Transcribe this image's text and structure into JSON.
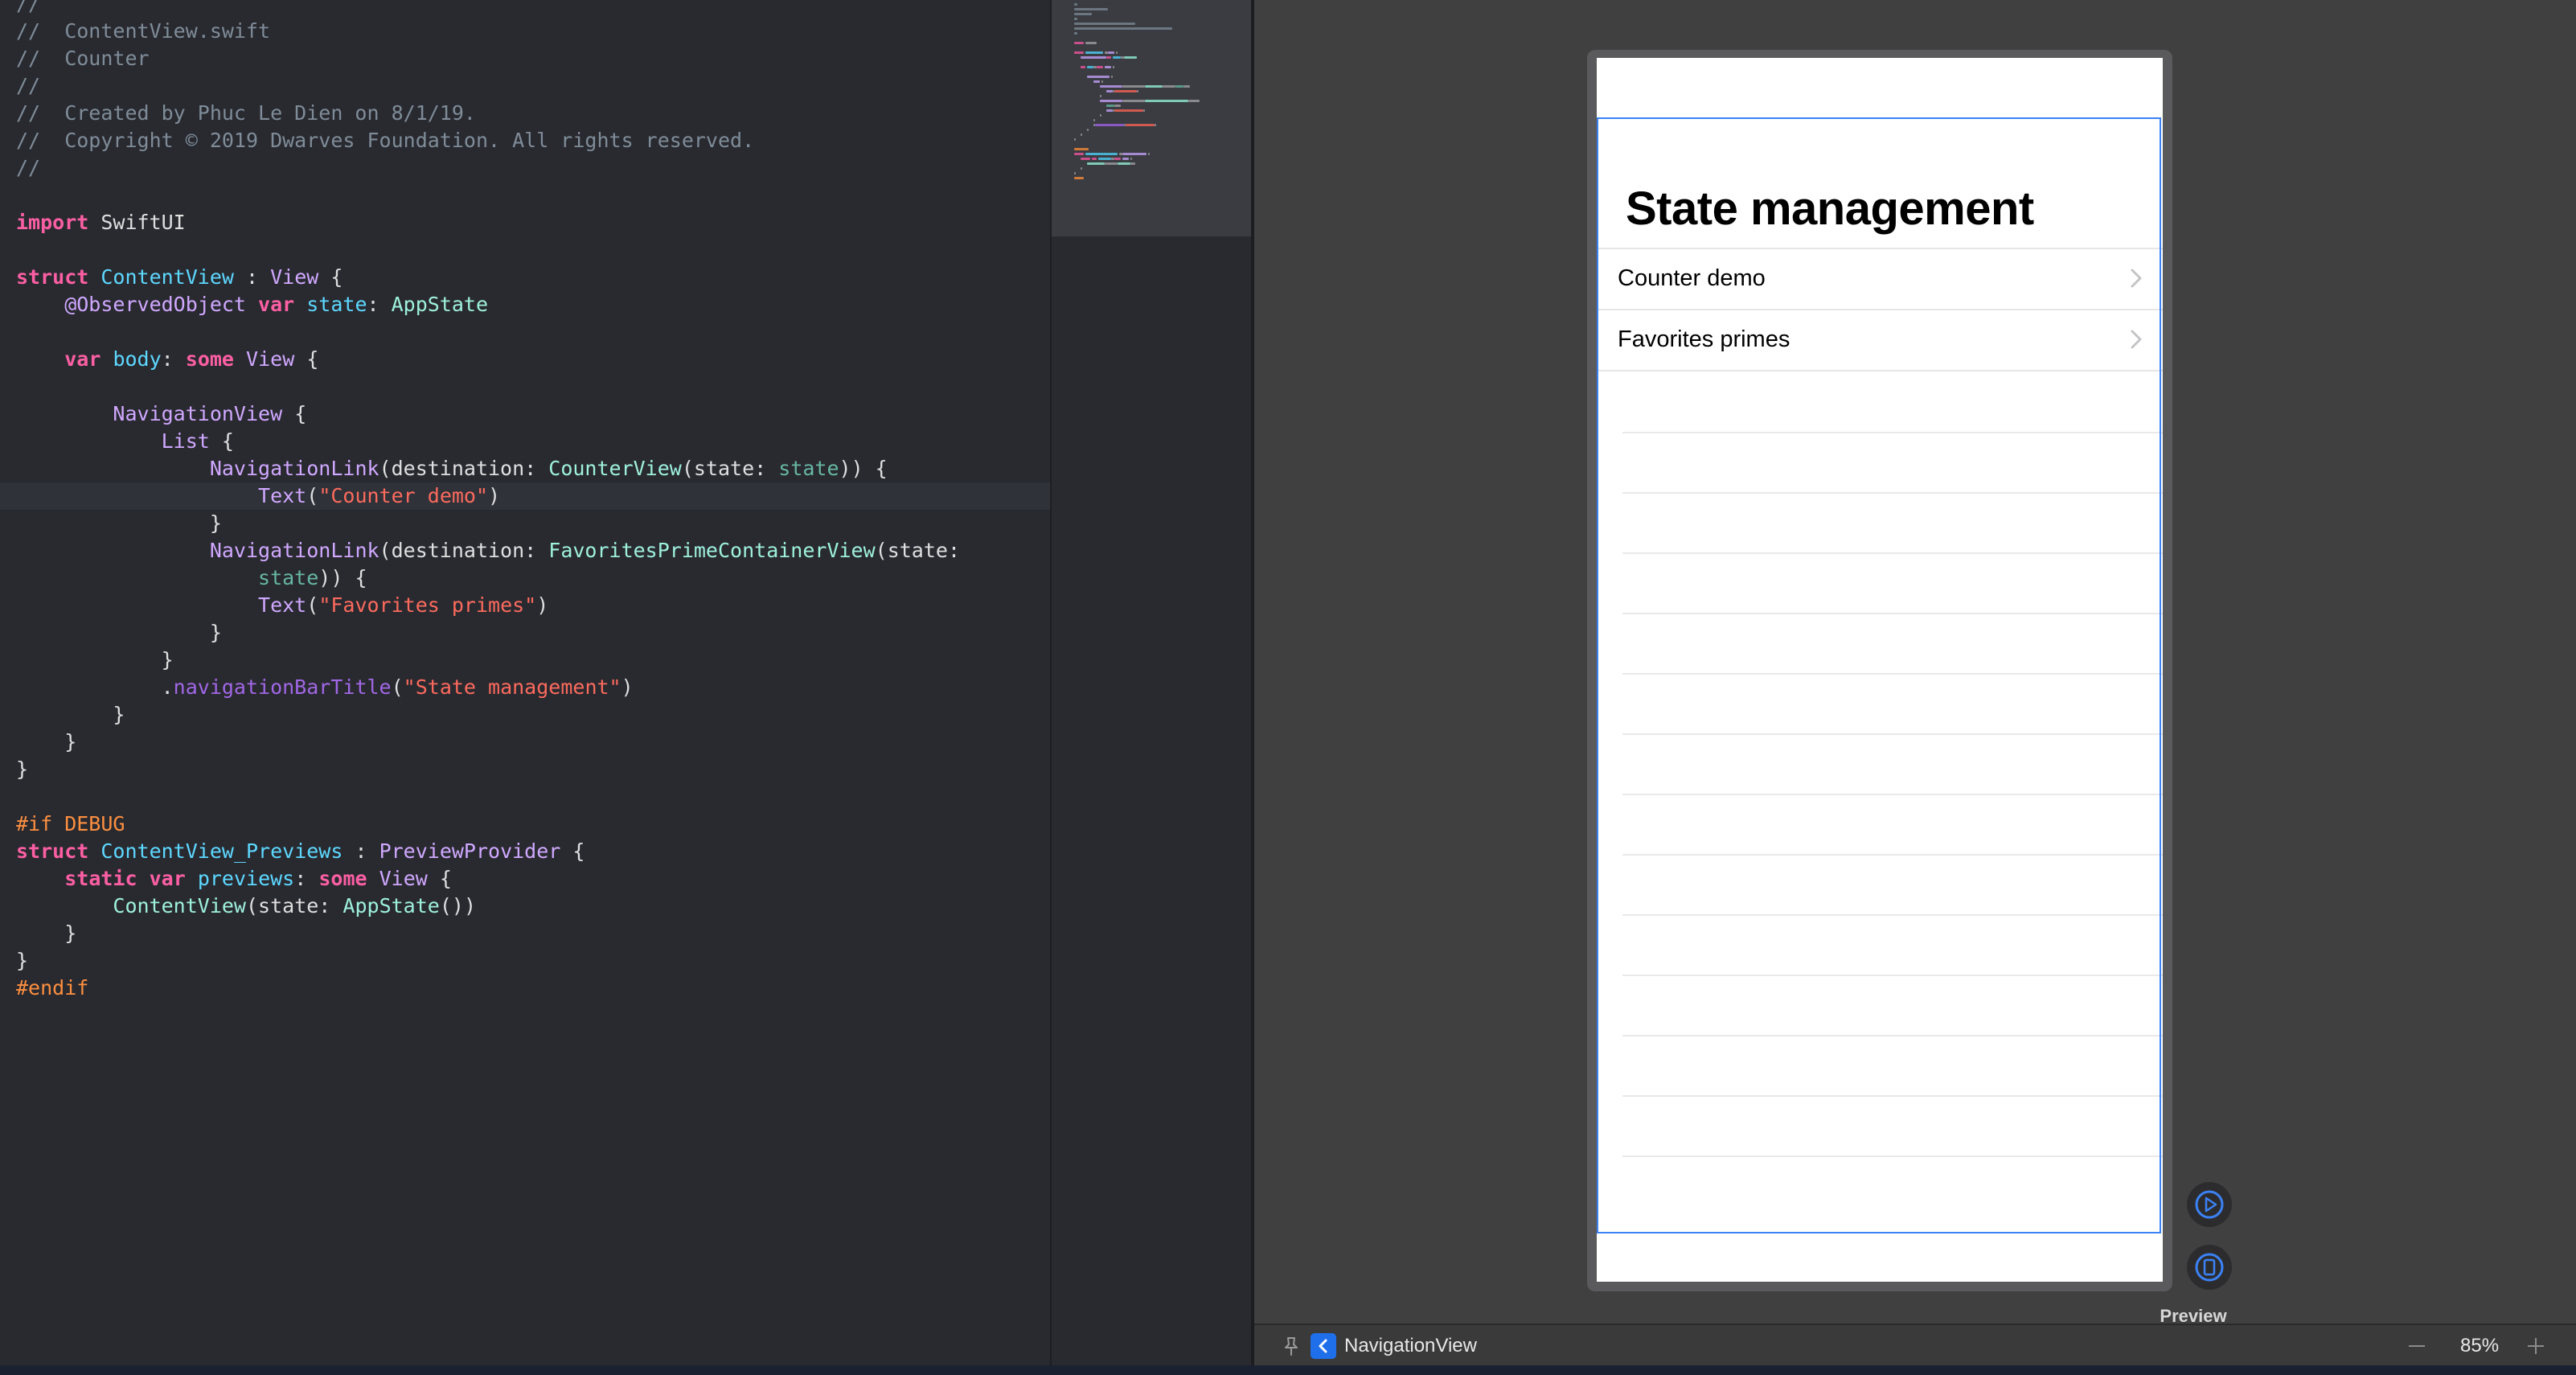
{
  "editor": {
    "file_comment": "//  ContentView.swift",
    "lines": [
      [
        {
          "t": "//",
          "c": "com"
        }
      ],
      [
        {
          "t": "//  ContentView.swift",
          "c": "com"
        }
      ],
      [
        {
          "t": "//  Counter",
          "c": "com"
        }
      ],
      [
        {
          "t": "//",
          "c": "com"
        }
      ],
      [
        {
          "t": "//  Created by Phuc Le Dien on 8/1/19.",
          "c": "com"
        }
      ],
      [
        {
          "t": "//  Copyright © 2019 Dwarves Foundation. All rights reserved.",
          "c": "com"
        }
      ],
      [
        {
          "t": "//",
          "c": "com"
        }
      ],
      [],
      [
        {
          "t": "import",
          "c": "kw"
        },
        {
          "t": " SwiftUI",
          "c": ""
        }
      ],
      [],
      [
        {
          "t": "struct",
          "c": "kw"
        },
        {
          "t": " ",
          "c": ""
        },
        {
          "t": "ContentView",
          "c": "decl"
        },
        {
          "t": " : ",
          "c": ""
        },
        {
          "t": "View",
          "c": "type"
        },
        {
          "t": " {",
          "c": ""
        }
      ],
      [
        {
          "t": "    @ObservedObject ",
          "c": "type"
        },
        {
          "t": "var",
          "c": "kw"
        },
        {
          "t": " ",
          "c": ""
        },
        {
          "t": "state",
          "c": "decl"
        },
        {
          "t": ": ",
          "c": ""
        },
        {
          "t": "AppState",
          "c": "proj"
        }
      ],
      [],
      [
        {
          "t": "    ",
          "c": ""
        },
        {
          "t": "var",
          "c": "kw"
        },
        {
          "t": " ",
          "c": ""
        },
        {
          "t": "body",
          "c": "decl"
        },
        {
          "t": ": ",
          "c": ""
        },
        {
          "t": "some",
          "c": "kw"
        },
        {
          "t": " ",
          "c": ""
        },
        {
          "t": "View",
          "c": "type"
        },
        {
          "t": " {",
          "c": ""
        }
      ],
      [],
      [
        {
          "t": "        ",
          "c": ""
        },
        {
          "t": "NavigationView",
          "c": "type"
        },
        {
          "t": " {",
          "c": ""
        }
      ],
      [
        {
          "t": "            ",
          "c": ""
        },
        {
          "t": "List",
          "c": "type"
        },
        {
          "t": " {",
          "c": ""
        }
      ],
      [
        {
          "t": "                ",
          "c": ""
        },
        {
          "t": "NavigationLink",
          "c": "type"
        },
        {
          "t": "(destination: ",
          "c": ""
        },
        {
          "t": "CounterView",
          "c": "proj"
        },
        {
          "t": "(state: ",
          "c": ""
        },
        {
          "t": "state",
          "c": "prop"
        },
        {
          "t": ")) {",
          "c": ""
        }
      ],
      [
        {
          "t": "                    ",
          "c": ""
        },
        {
          "t": "Text",
          "c": "type"
        },
        {
          "t": "(",
          "c": ""
        },
        {
          "t": "\"Counter demo\"",
          "c": "str"
        },
        {
          "t": ")",
          "c": ""
        }
      ],
      [
        {
          "t": "                }",
          "c": ""
        }
      ],
      [
        {
          "t": "                ",
          "c": ""
        },
        {
          "t": "NavigationLink",
          "c": "type"
        },
        {
          "t": "(destination: ",
          "c": ""
        },
        {
          "t": "FavoritesPrimeContainerView",
          "c": "proj"
        },
        {
          "t": "(state:",
          "c": ""
        }
      ],
      [
        {
          "t": "                    ",
          "c": ""
        },
        {
          "t": "state",
          "c": "prop"
        },
        {
          "t": ")) {",
          "c": ""
        }
      ],
      [
        {
          "t": "                    ",
          "c": ""
        },
        {
          "t": "Text",
          "c": "type"
        },
        {
          "t": "(",
          "c": ""
        },
        {
          "t": "\"Favorites primes\"",
          "c": "str"
        },
        {
          "t": ")",
          "c": ""
        }
      ],
      [
        {
          "t": "                }",
          "c": ""
        }
      ],
      [
        {
          "t": "            }",
          "c": ""
        }
      ],
      [
        {
          "t": "            .",
          "c": ""
        },
        {
          "t": "navigationBarTitle",
          "c": "meth"
        },
        {
          "t": "(",
          "c": ""
        },
        {
          "t": "\"State management\"",
          "c": "str"
        },
        {
          "t": ")",
          "c": ""
        }
      ],
      [
        {
          "t": "        }",
          "c": ""
        }
      ],
      [
        {
          "t": "    }",
          "c": ""
        }
      ],
      [
        {
          "t": "}",
          "c": ""
        }
      ],
      [],
      [
        {
          "t": "#if DEBUG",
          "c": "pre"
        }
      ],
      [
        {
          "t": "struct",
          "c": "kw"
        },
        {
          "t": " ",
          "c": ""
        },
        {
          "t": "ContentView_Previews",
          "c": "decl"
        },
        {
          "t": " : ",
          "c": ""
        },
        {
          "t": "PreviewProvider",
          "c": "type"
        },
        {
          "t": " {",
          "c": ""
        }
      ],
      [
        {
          "t": "    ",
          "c": ""
        },
        {
          "t": "static",
          "c": "kw"
        },
        {
          "t": " ",
          "c": ""
        },
        {
          "t": "var",
          "c": "kw"
        },
        {
          "t": " ",
          "c": ""
        },
        {
          "t": "previews",
          "c": "decl"
        },
        {
          "t": ": ",
          "c": ""
        },
        {
          "t": "some",
          "c": "kw"
        },
        {
          "t": " ",
          "c": ""
        },
        {
          "t": "View",
          "c": "type"
        },
        {
          "t": " {",
          "c": ""
        }
      ],
      [
        {
          "t": "        ",
          "c": ""
        },
        {
          "t": "ContentView",
          "c": "proj"
        },
        {
          "t": "(state: ",
          "c": ""
        },
        {
          "t": "AppState",
          "c": "proj"
        },
        {
          "t": "())",
          "c": ""
        }
      ],
      [
        {
          "t": "    }",
          "c": ""
        }
      ],
      [
        {
          "t": "}",
          "c": ""
        }
      ],
      [
        {
          "t": "#endif",
          "c": "pre"
        }
      ]
    ],
    "current_line_index": 18
  },
  "preview": {
    "nav_title": "State management",
    "rows": [
      {
        "label": "Counter demo"
      },
      {
        "label": "Favorites primes"
      }
    ],
    "empty_row_count": 14,
    "label": "Preview",
    "live_button_icon": "play-circle-icon",
    "device_button_icon": "device-icon"
  },
  "bottombar": {
    "breadcrumb": "NavigationView",
    "zoom": "85%"
  },
  "colors": {
    "editor_bg": "#292a30",
    "canvas_bg": "#404040",
    "selection": "#3b82f6",
    "keyword": "#fc5fa3",
    "string": "#fc6a5d"
  }
}
